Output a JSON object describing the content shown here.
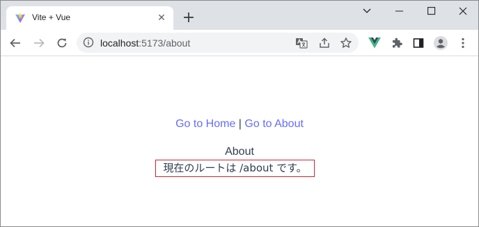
{
  "browser": {
    "tab": {
      "title": "Vite + Vue",
      "close_glyph": "✕",
      "favicon_icon": "vite-logo-icon"
    },
    "new_tab_glyph": "+",
    "window_controls": [
      "tab-search-icon",
      "minimize-icon",
      "maximize-icon",
      "close-icon"
    ]
  },
  "toolbar": {
    "back_icon": "arrow-left-icon",
    "forward_icon": "arrow-right-icon",
    "reload_icon": "reload-icon",
    "address": {
      "host": "localhost",
      "rest": ":5173/about"
    },
    "omnibox_icons": [
      "translate-icon",
      "share-icon",
      "star-icon"
    ],
    "extension_icons": [
      "vue-devtools-icon",
      "puzzle-icon",
      "side-panel-icon",
      "profile-icon",
      "kebab-menu-icon"
    ]
  },
  "page": {
    "nav": {
      "home_link": "Go to Home",
      "separator": "|",
      "about_link": "Go to About"
    },
    "title": "About",
    "route_text": "現在のルートは /about です。"
  },
  "colors": {
    "link": "#646cff",
    "text": "#2c3e50",
    "highlight_border": "#c0272d",
    "tabstrip": "#dee1e6"
  }
}
